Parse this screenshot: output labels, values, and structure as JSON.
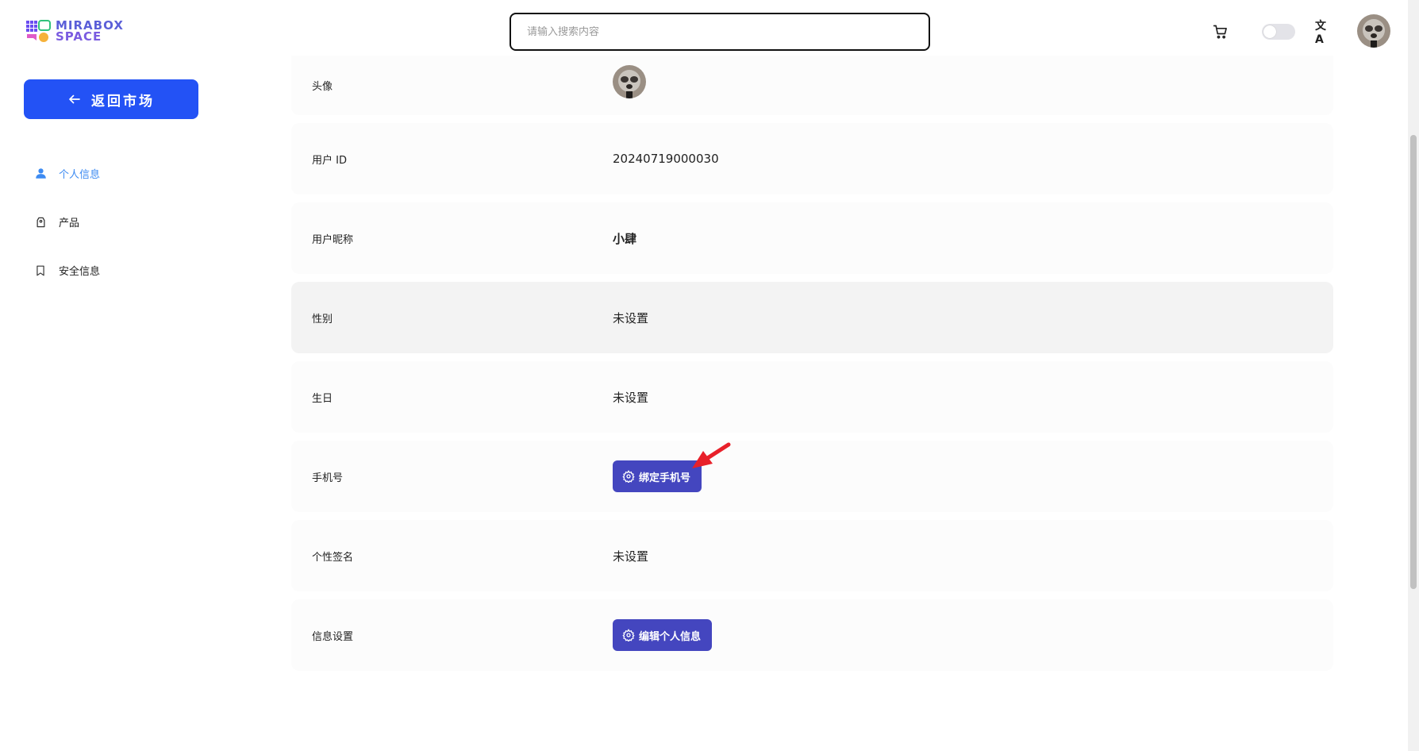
{
  "header": {
    "logo_line1": "MIRABOX",
    "logo_line2": "SPACE",
    "search_placeholder": "请输入搜索内容",
    "translate_glyph": "文A"
  },
  "sidebar": {
    "back_label": "返回市场",
    "items": [
      {
        "label": "个人信息",
        "icon": "user-icon",
        "active": true
      },
      {
        "label": "产品",
        "icon": "tag-icon",
        "active": false
      },
      {
        "label": "安全信息",
        "icon": "bookmark-icon",
        "active": false
      }
    ]
  },
  "profile": {
    "avatar_label": "头像",
    "user_id_label": "用户 ID",
    "user_id": "20240719000030",
    "nickname_label": "用户昵称",
    "nickname": "小肆",
    "gender_label": "性别",
    "gender": "未设置",
    "birthday_label": "生日",
    "birthday": "未设置",
    "phone_label": "手机号",
    "bind_phone_button": "绑定手机号",
    "signature_label": "个性签名",
    "signature": "未设置",
    "settings_label": "信息设置",
    "edit_button": "编辑个人信息"
  },
  "colors": {
    "primary_blue": "#2352f5",
    "action_purple": "#4446bf",
    "active_nav": "#3d8bf2",
    "annotation_arrow": "#e8202a"
  }
}
